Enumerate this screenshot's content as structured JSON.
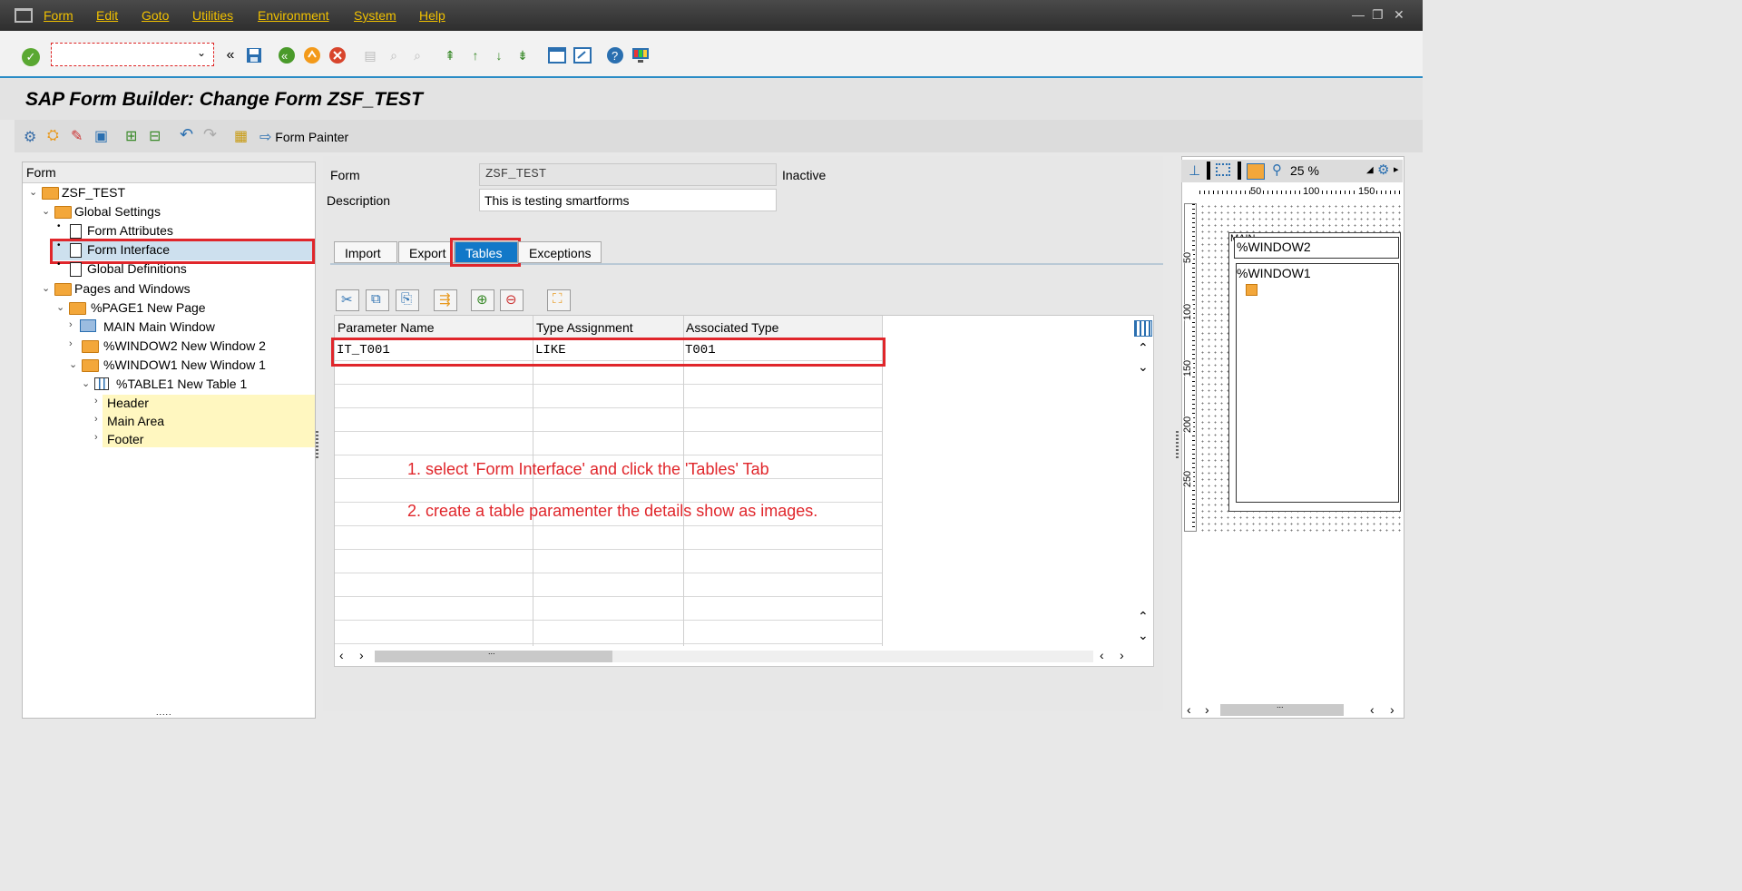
{
  "menu": [
    "Form",
    "Edit",
    "Goto",
    "Utilities",
    "Environment",
    "System",
    "Help"
  ],
  "title": "SAP Form Builder: Change Form ZSF_TEST",
  "app_toolbar": {
    "form_painter": "Form Painter"
  },
  "tree": {
    "header": "Form",
    "items": [
      {
        "label": "ZSF_TEST"
      },
      {
        "label": "Global Settings"
      },
      {
        "label": "Form Attributes"
      },
      {
        "label": "Form Interface"
      },
      {
        "label": "Global Definitions"
      },
      {
        "label": "Pages and Windows"
      },
      {
        "label": "%PAGE1 New Page"
      },
      {
        "label": "MAIN Main Window"
      },
      {
        "label": "%WINDOW2 New Window 2"
      },
      {
        "label": "%WINDOW1 New Window 1"
      },
      {
        "label": "%TABLE1 New Table 1"
      },
      {
        "label": "Header"
      },
      {
        "label": "Main Area"
      },
      {
        "label": "Footer"
      }
    ],
    "bottom_handle": "....."
  },
  "form_fields": {
    "form_label": "Form",
    "form_value": "ZSF_TEST",
    "status": "Inactive",
    "desc_label": "Description",
    "desc_value": "This is testing smartforms"
  },
  "tabs": [
    "Import",
    "Export",
    "Tables",
    "Exceptions"
  ],
  "table": {
    "columns": [
      "Parameter Name",
      "Type Assignment",
      "Associated Type"
    ],
    "rows": [
      [
        "IT_T001",
        "LIKE",
        "T001"
      ]
    ],
    "scroll_handle": "..."
  },
  "annotations": [
    "1. select 'Form Interface' and click the 'Tables' Tab",
    "2. create a table paramenter the details show as images."
  ],
  "painter": {
    "zoom": "25 %",
    "ruler_h": [
      "50",
      "100",
      "150"
    ],
    "ruler_v": [
      "50",
      "100",
      "150",
      "200",
      "250"
    ],
    "windows": [
      "%WINDOW2",
      "%WINDOW1"
    ],
    "main_label": "MAIN",
    "scroll_handle": "..."
  }
}
